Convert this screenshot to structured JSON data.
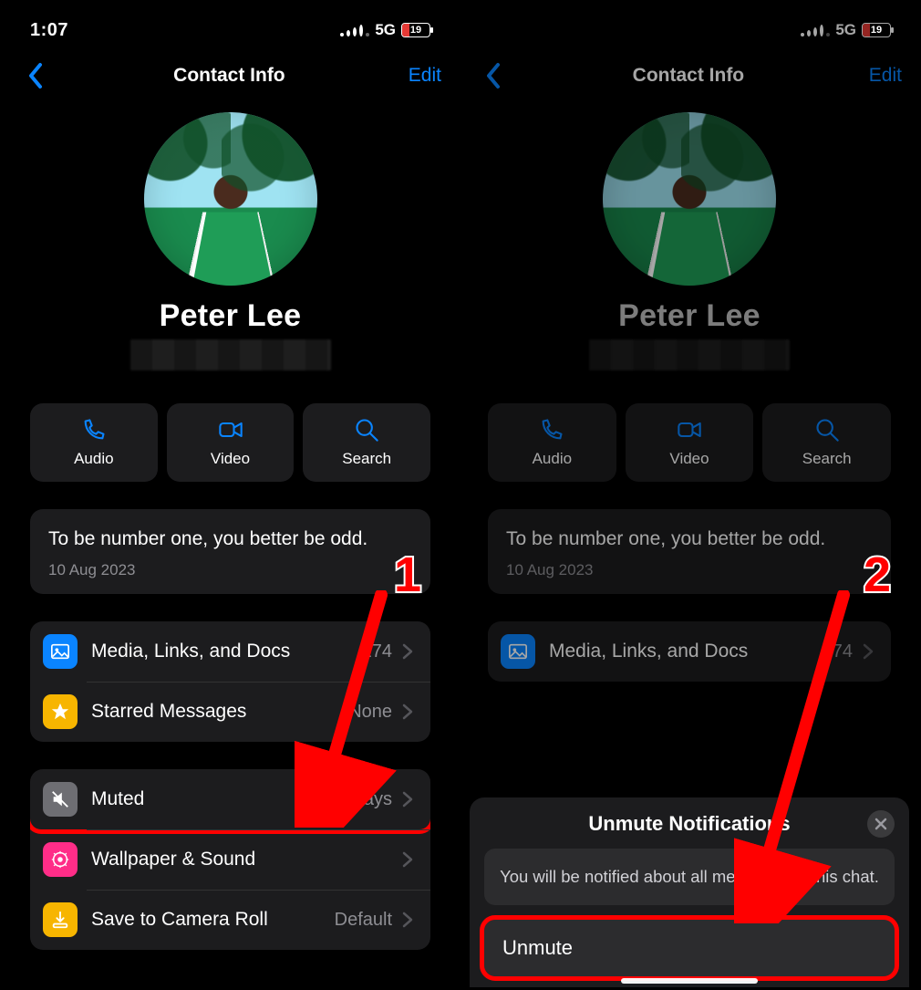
{
  "colors": {
    "accent": "#0a84ff",
    "red": "#ff0000",
    "battery": "#e53935"
  },
  "status": {
    "time": "1:07",
    "network": "5G",
    "battery_pct": "19"
  },
  "nav": {
    "title": "Contact Info",
    "edit": "Edit"
  },
  "contact": {
    "name": "Peter Lee"
  },
  "actions": {
    "audio": "Audio",
    "video": "Video",
    "search": "Search"
  },
  "quote": {
    "text": "To be number one, you better be odd.",
    "date": "10 Aug 2023"
  },
  "rows": {
    "media": {
      "label": "Media, Links, and Docs",
      "count": "274"
    },
    "starred": {
      "label": "Starred Messages",
      "value": "None"
    },
    "muted": {
      "label": "Muted",
      "value": "Always"
    },
    "wallpaper": {
      "label": "Wallpaper & Sound"
    },
    "save": {
      "label": "Save to Camera Roll",
      "value": "Default"
    }
  },
  "steps": {
    "one": "1",
    "two": "2"
  },
  "sheet": {
    "title": "Unmute Notifications",
    "message": "You will be notified about all messages in this chat.",
    "button": "Unmute"
  }
}
